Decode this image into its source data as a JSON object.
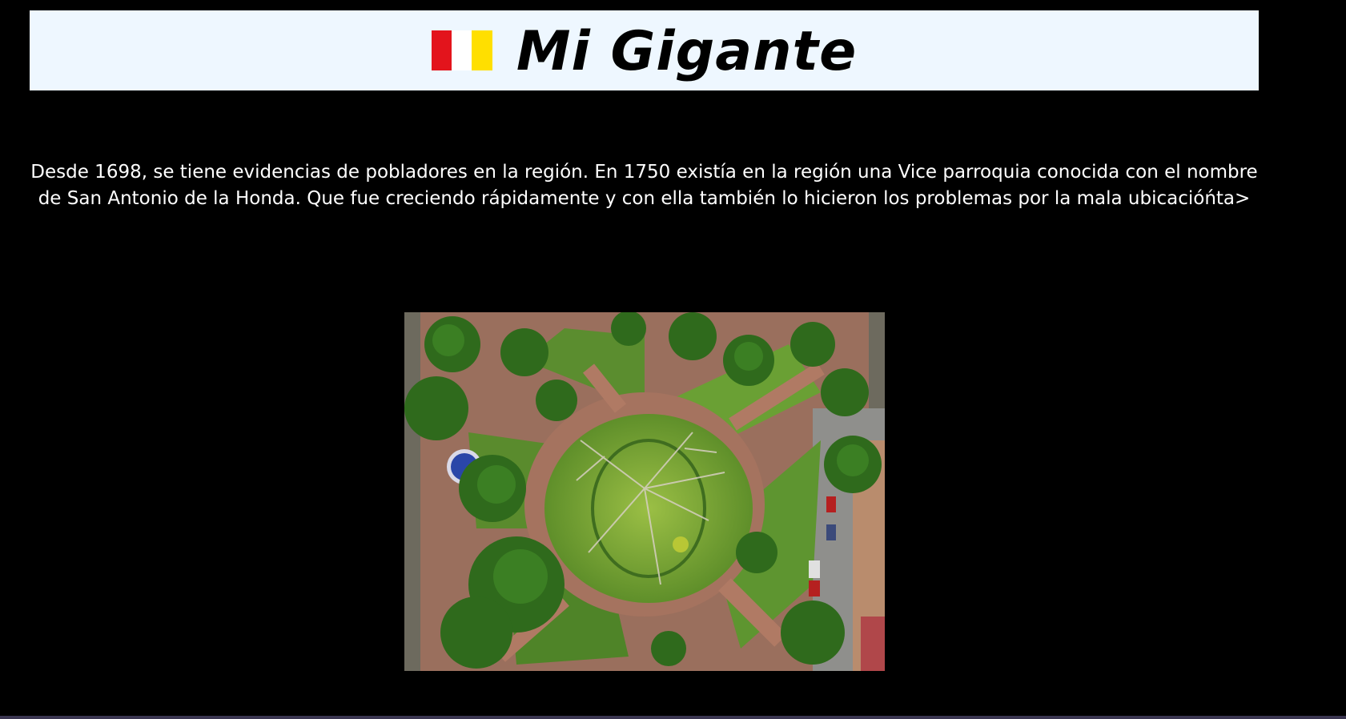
{
  "header": {
    "title": "Mi Gigante",
    "flag_colors": [
      "#e3141c",
      "#ffffff",
      "#ffdf00"
    ]
  },
  "intro": {
    "text": "Desde 1698, se tiene evidencias de pobladores en la región. En 1750 existía en la región una Vice parroquia conocida con el nombre de San Antonio de la Honda. Que fue creciendo rápidamente y con ella también lo hicieron los problemas por la mala ubicacióńta>"
  },
  "photo": {
    "subject": "aerial-park-photo"
  },
  "colors": {
    "background": "#000000",
    "banner": "#eef7ff",
    "text": "#ffffff"
  }
}
